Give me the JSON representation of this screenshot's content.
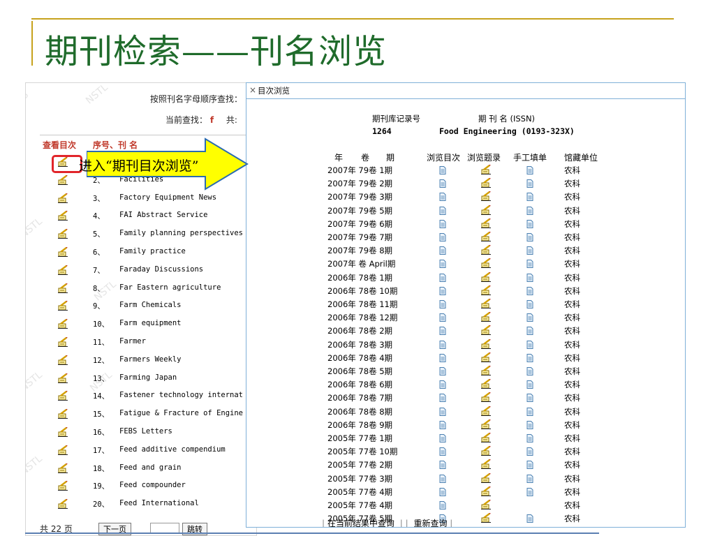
{
  "slide": {
    "title": "期刊检索——刊名浏览"
  },
  "left_panel": {
    "search_by": "按照刊名字母顺序查找：",
    "current_search_label": "当前查找：",
    "current_letter": "f",
    "total_prefix": "共:",
    "col_view_toc": "查看目次",
    "col_seq_name": "序号、刊 名",
    "rows": [
      {
        "num": "",
        "name": ""
      },
      {
        "num": "2、",
        "name": "Facilities"
      },
      {
        "num": "3、",
        "name": "Factory Equipment News"
      },
      {
        "num": "4、",
        "name": "FAI Abstract Service"
      },
      {
        "num": "5、",
        "name": "Family planning perspectives"
      },
      {
        "num": "6、",
        "name": "Family practice"
      },
      {
        "num": "7、",
        "name": "Faraday Discussions"
      },
      {
        "num": "8、",
        "name": "Far Eastern agriculture"
      },
      {
        "num": "9、",
        "name": "Farm Chemicals"
      },
      {
        "num": "10、",
        "name": "Farm equipment"
      },
      {
        "num": "11、",
        "name": "Farmer"
      },
      {
        "num": "12、",
        "name": "Farmers Weekly"
      },
      {
        "num": "13、",
        "name": "Farming Japan"
      },
      {
        "num": "14、",
        "name": "Fastener technology internat"
      },
      {
        "num": "15、",
        "name": "Fatigue & Fracture of Engine"
      },
      {
        "num": "16、",
        "name": "FEBS Letters"
      },
      {
        "num": "17、",
        "name": "Feed additive compendium"
      },
      {
        "num": "18、",
        "name": "Feed and grain"
      },
      {
        "num": "19、",
        "name": "Feed compounder"
      },
      {
        "num": "20、",
        "name": "Feed International"
      }
    ],
    "footer_text": "共 22 页",
    "next_page": "下一页",
    "jump": "跳转"
  },
  "annotation": {
    "label": "进入“期刊目次浏览”"
  },
  "right_window": {
    "close": "×",
    "title": "目次浏览",
    "record_no_label": "期刊库记录号",
    "journal_name_label": "期 刊 名 (ISSN)",
    "record_no": "1264",
    "journal_name": "Food Engineering (0193-323X)",
    "col_year": "年",
    "col_vol": "卷",
    "col_issue": "期",
    "col_browse_toc": "浏览目次",
    "col_browse_titles": "浏览题录",
    "col_manual_form": "手工填单",
    "col_library": "馆藏单位",
    "issues": [
      {
        "label": "2007年 79卷 1期",
        "lib": "农科",
        "manual": true
      },
      {
        "label": "2007年 79卷 2期",
        "lib": "农科",
        "manual": true
      },
      {
        "label": "2007年 79卷 3期",
        "lib": "农科",
        "manual": true
      },
      {
        "label": "2007年 79卷 5期",
        "lib": "农科",
        "manual": true
      },
      {
        "label": "2007年 79卷 6期",
        "lib": "农科",
        "manual": true
      },
      {
        "label": "2007年 79卷 7期",
        "lib": "农科",
        "manual": true
      },
      {
        "label": "2007年 79卷 8期",
        "lib": "农科",
        "manual": true
      },
      {
        "label": "2007年 卷  April期",
        "lib": "农科",
        "manual": true
      },
      {
        "label": "2006年 78卷 1期",
        "lib": "农科",
        "manual": true
      },
      {
        "label": "2006年 78卷 10期",
        "lib": "农科",
        "manual": true
      },
      {
        "label": "2006年 78卷 11期",
        "lib": "农科",
        "manual": true
      },
      {
        "label": "2006年 78卷 12期",
        "lib": "农科",
        "manual": true
      },
      {
        "label": "2006年 78卷 2期",
        "lib": "农科",
        "manual": true
      },
      {
        "label": "2006年 78卷 3期",
        "lib": "农科",
        "manual": true
      },
      {
        "label": "2006年 78卷 4期",
        "lib": "农科",
        "manual": true
      },
      {
        "label": "2006年 78卷 5期",
        "lib": "农科",
        "manual": true
      },
      {
        "label": "2006年 78卷 6期",
        "lib": "农科",
        "manual": true
      },
      {
        "label": "2006年 78卷 7期",
        "lib": "农科",
        "manual": true
      },
      {
        "label": "2006年 78卷 8期",
        "lib": "农科",
        "manual": true
      },
      {
        "label": "2006年 78卷 9期",
        "lib": "农科",
        "manual": true
      },
      {
        "label": "2005年 77卷 1期",
        "lib": "农科",
        "manual": true
      },
      {
        "label": "2005年 77卷 10期",
        "lib": "农科",
        "manual": true
      },
      {
        "label": "2005年 77卷 2期",
        "lib": "农科",
        "manual": true
      },
      {
        "label": "2005年 77卷 3期",
        "lib": "农科",
        "manual": true
      },
      {
        "label": "2005年 77卷 4期",
        "lib": "农科",
        "manual": true
      },
      {
        "label": "2005年 77卷 4期",
        "lib": "农科",
        "manual": false
      },
      {
        "label": "2005年 77卷 5期",
        "lib": "农科",
        "manual": true
      }
    ],
    "footer_search_in_results": "在当前结果中查询",
    "footer_new_search": "重新查询"
  },
  "colors": {
    "title_green": "#1f6b2b",
    "rule_gold": "#c7a21d",
    "accent_red": "#c0392b",
    "highlight_red": "#e1252a",
    "arrow_fill": "#ffff00",
    "arrow_stroke": "#2b6cb0",
    "window_border": "#7fb0d8"
  },
  "icons": {
    "view_toc": "pencil-book-icon",
    "browse_toc": "document-icon",
    "manual_form": "document-icon"
  }
}
